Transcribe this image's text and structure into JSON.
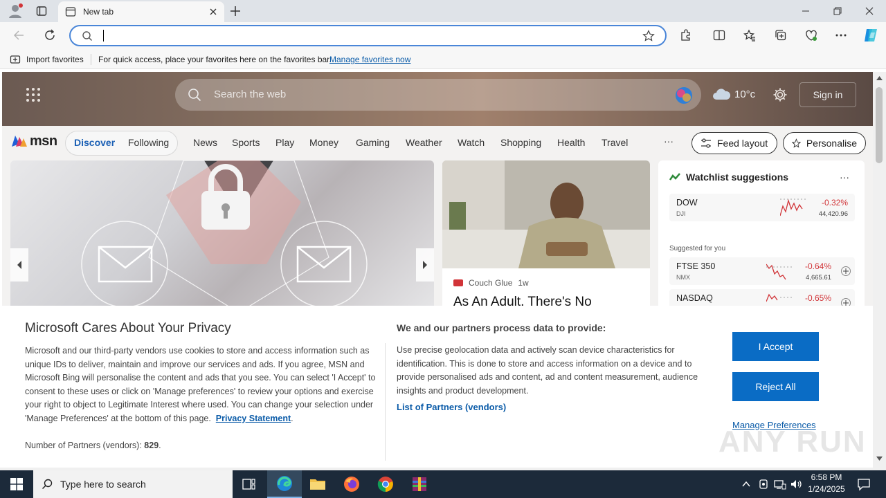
{
  "browser": {
    "tab_title": "New tab",
    "address_value": "",
    "favorites_bar": {
      "import_label": "Import favorites",
      "hint_text": "For quick access, place your favorites here on the favorites bar.",
      "manage_link": "Manage favorites now"
    }
  },
  "msn": {
    "search_placeholder": "Search the web",
    "weather_temp": "10°c",
    "sign_in": "Sign in",
    "logo_text": "msn",
    "tabs": [
      "Discover",
      "Following"
    ],
    "nav": [
      "News",
      "Sports",
      "Play",
      "Money",
      "Gaming",
      "Weather",
      "Watch",
      "Shopping",
      "Health",
      "Travel"
    ],
    "more": "···",
    "feed_layout": "Feed layout",
    "personalise": "Personalise",
    "article": {
      "source": "Couch Glue",
      "age": "1w",
      "headline": "As An Adult, There's No"
    },
    "watchlist": {
      "title": "Watchlist suggestions",
      "suggested_label": "Suggested for you",
      "stocks": [
        {
          "name": "DOW",
          "sub": "DJI",
          "change": "-0.32%",
          "price": "44,420.96"
        },
        {
          "name": "FTSE 350",
          "sub": "NMX",
          "change": "-0.64%",
          "price": "4,665.61"
        },
        {
          "name": "NASDAQ",
          "sub": "",
          "change": "-0.65%",
          "price": ""
        }
      ]
    }
  },
  "privacy": {
    "title": "Microsoft Cares About Your Privacy",
    "body": "Microsoft and our third-party vendors use cookies to store and access information such as unique IDs to deliver, maintain and improve our services and ads. If you agree, MSN and Microsoft Bing will personalise the content and ads that you see. You can select 'I Accept' to consent to these uses or click on 'Manage preferences' to review your options and exercise your right to object to Legitimate Interest where used.  You can change your selection under 'Manage Preferences' at the bottom of this page.",
    "privacy_link": "Privacy Statement",
    "partners_label": "Number of Partners (vendors):",
    "partners_count": "829",
    "right_title": "We and our partners process data to provide:",
    "right_body": "Use precise geolocation data and actively scan device characteristics for identification. This is done to store and access information on a device and to provide personalised ads and content, ad and content measurement, audience insights and product development.",
    "list_link": "List of Partners (vendors)",
    "accept": "I Accept",
    "reject": "Reject All",
    "manage": "Manage Preferences"
  },
  "taskbar": {
    "search_placeholder": "Type here to search",
    "time": "6:58 PM",
    "date": "1/24/2025"
  },
  "watermark": "ANY RUN",
  "colors": {
    "accent": "#0a6cc5",
    "negative": "#d13438",
    "taskbar": "#1c2a3a"
  }
}
